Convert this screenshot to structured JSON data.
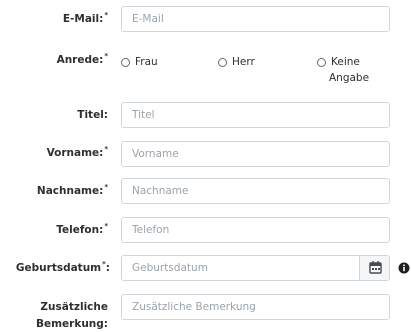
{
  "form": {
    "email": {
      "label": "E-Mail:",
      "required_mark": "*",
      "placeholder": "E-Mail"
    },
    "anrede": {
      "label": "Anrede:",
      "required_mark": "*",
      "options": [
        "Frau",
        "Herr",
        "Keine",
        "Angabe"
      ]
    },
    "titel": {
      "label": "Titel:",
      "placeholder": "Titel"
    },
    "vorname": {
      "label": "Vorname:",
      "required_mark": "*",
      "placeholder": "Vorname"
    },
    "nachname": {
      "label": "Nachname:",
      "required_mark": "*",
      "placeholder": "Nachname"
    },
    "telefon": {
      "label": "Telefon:",
      "required_mark": "*",
      "placeholder": "Telefon"
    },
    "geburtsdatum": {
      "label": "Geburtsdatum",
      "required_mark": "*",
      "colon": ":",
      "placeholder": "Geburtsdatum"
    },
    "bemerkung": {
      "label_line1": "Zusätzliche",
      "label_line2": "Bemerkung:",
      "placeholder": "Zusätzliche Bemerkung"
    }
  },
  "icons": {
    "calendar": "calendar-icon",
    "info": "info-icon"
  }
}
